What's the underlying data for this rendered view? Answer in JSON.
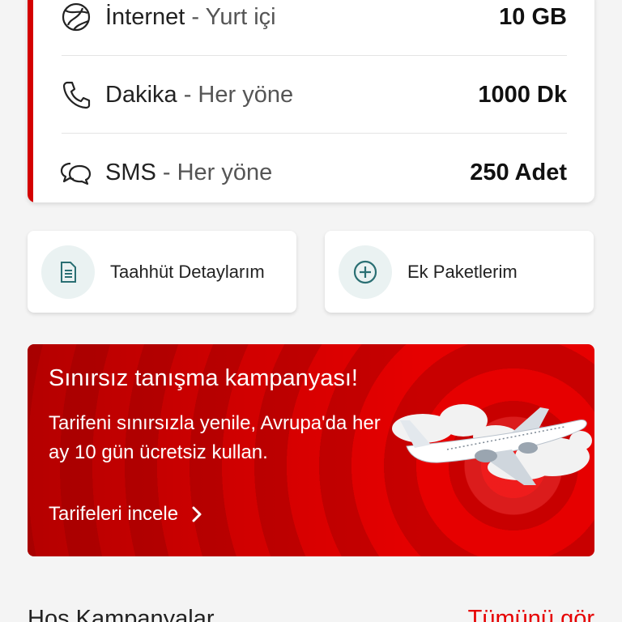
{
  "usage": {
    "items": [
      {
        "label": "İnternet",
        "sub": " - Yurt içi",
        "value": "10 GB",
        "icon": "globe-icon"
      },
      {
        "label": "Dakika",
        "sub": " - Her yöne",
        "value": "1000 Dk",
        "icon": "phone-icon"
      },
      {
        "label": "SMS",
        "sub": " - Her yöne",
        "value": "250 Adet",
        "icon": "chat-icon"
      }
    ],
    "accent_color": "#d40000"
  },
  "quick_links": [
    {
      "label": "Taahhüt Detaylarım",
      "icon": "document-icon"
    },
    {
      "label": "Ek Paketlerim",
      "icon": "add-package-icon"
    }
  ],
  "promo": {
    "title": "Sınırsız tanışma kampanyası!",
    "description": "Tarifeni sınırsızla yenile, Avrupa'da her ay 10 gün ücretsiz kullan.",
    "link": "Tarifeleri incele",
    "background_color": "#e60000"
  },
  "section": {
    "title": "Hoş Kampanyalar",
    "link": "Tümünü gör"
  },
  "colors": {
    "brand_red": "#e60000",
    "icon_teal": "#2a6f73"
  }
}
